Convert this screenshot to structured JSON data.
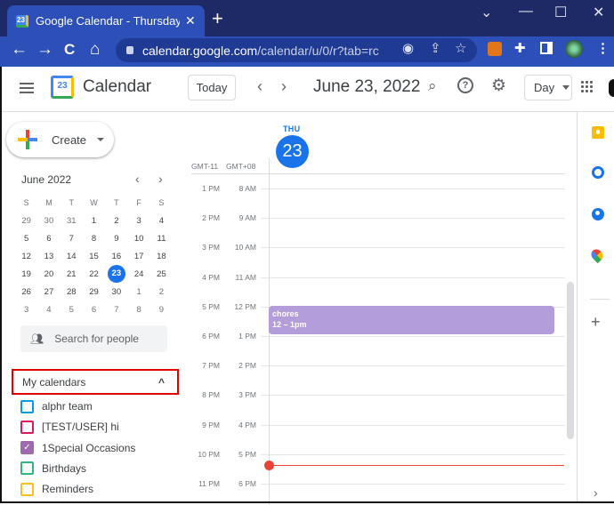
{
  "browser": {
    "tab_title": "Google Calendar - Thursday, June",
    "tab_favicon_text": "23",
    "tab_close": "✕",
    "new_tab": "+",
    "window_controls": {
      "dropdown": "⌄",
      "minimize": "—",
      "maximize": "☐",
      "close": "✕"
    },
    "nav": {
      "back": "←",
      "forward": "→",
      "reload": "C",
      "home": "⌂"
    },
    "url_host": "calendar.google.com",
    "url_path": "/calendar/u/0/r?tab=rc",
    "omnibox_icons": [
      "eye-icon",
      "share-icon",
      "star-icon"
    ],
    "extensions": [
      "metamask-icon",
      "extensions-puzzle-icon",
      "sidepanel-icon",
      "profile-avatar"
    ],
    "menu": "⋮"
  },
  "header": {
    "app_title": "Calendar",
    "logo_text": "23",
    "today_label": "Today",
    "prev": "‹",
    "next": "›",
    "date_title": "June 23, 2022",
    "view_label": "Day"
  },
  "sidebar": {
    "create_label": "Create",
    "mini_calendar": {
      "title": "June 2022",
      "prev": "‹",
      "next": "›",
      "weekdays": [
        "S",
        "M",
        "T",
        "W",
        "T",
        "F",
        "S"
      ],
      "weeks": [
        [
          "29",
          "30",
          "31",
          "1",
          "2",
          "3",
          "4"
        ],
        [
          "5",
          "6",
          "7",
          "8",
          "9",
          "10",
          "11"
        ],
        [
          "12",
          "13",
          "14",
          "15",
          "16",
          "17",
          "18"
        ],
        [
          "19",
          "20",
          "21",
          "22",
          "23",
          "24",
          "25"
        ],
        [
          "26",
          "27",
          "28",
          "29",
          "30",
          "1",
          "2"
        ],
        [
          "3",
          "4",
          "5",
          "6",
          "7",
          "8",
          "9"
        ]
      ],
      "selected": "23"
    },
    "search_people_placeholder": "Search for people",
    "my_calendars": {
      "title": "My calendars",
      "collapse": "^",
      "items": [
        {
          "name": "alphr team",
          "color": "#039be5",
          "checked": false
        },
        {
          "name": "[TEST/USER] hi",
          "color": "#d81b60",
          "checked": false
        },
        {
          "name": "1Special Occasions",
          "color": "#9e69af",
          "checked": true
        },
        {
          "name": "Birthdays",
          "color": "#33b679",
          "checked": false
        },
        {
          "name": "Reminders",
          "color": "#f6bf26",
          "checked": false
        }
      ]
    }
  },
  "day_view": {
    "day_of_week": "THU",
    "day_number": "23",
    "timezones": [
      "GMT-11",
      "GMT+08"
    ],
    "hours": [
      {
        "tz1": "1 PM",
        "tz2": "8 AM"
      },
      {
        "tz1": "2 PM",
        "tz2": "9 AM"
      },
      {
        "tz1": "3 PM",
        "tz2": "10 AM"
      },
      {
        "tz1": "4 PM",
        "tz2": "11 AM"
      },
      {
        "tz1": "5 PM",
        "tz2": "12 PM"
      },
      {
        "tz1": "6 PM",
        "tz2": "1 PM"
      },
      {
        "tz1": "7 PM",
        "tz2": "2 PM"
      },
      {
        "tz1": "8 PM",
        "tz2": "3 PM"
      },
      {
        "tz1": "9 PM",
        "tz2": "4 PM"
      },
      {
        "tz1": "10 PM",
        "tz2": "5 PM"
      },
      {
        "tz1": "11 PM",
        "tz2": "6 PM"
      }
    ],
    "events": [
      {
        "title": "chores",
        "time": "12 – 1pm",
        "color": "#b39ddb"
      }
    ]
  },
  "side_panel": {
    "apps": [
      "keep-icon",
      "tasks-icon",
      "contacts-icon",
      "maps-icon"
    ],
    "add": "+",
    "expand": "›"
  },
  "colors": {
    "accent": "#1a73e8",
    "now_line": "#ea4335",
    "highlight_box": "#e00000"
  }
}
